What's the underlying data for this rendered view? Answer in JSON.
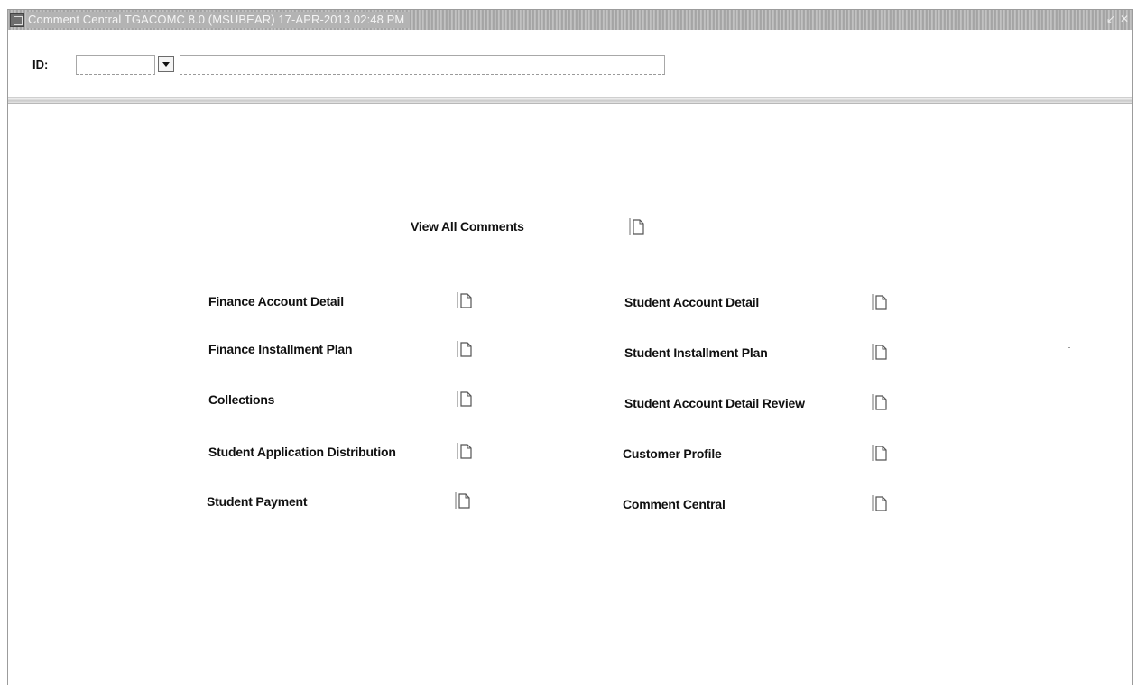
{
  "window": {
    "title": "Comment Central  TGACOMC  8.0  (MSUBEAR)   17-APR-2013 02:48 PM",
    "controls": [
      "↙",
      "✕"
    ]
  },
  "key_block": {
    "id_label": "ID:",
    "id_value": "",
    "name_value": ""
  },
  "main": {
    "view_all": {
      "label": "View All Comments",
      "icon": "document-icon"
    },
    "left_options": [
      {
        "label": "Finance Account Detail",
        "icon": "document-icon"
      },
      {
        "label": "Finance Installment Plan",
        "icon": "document-icon"
      },
      {
        "label": "Collections",
        "icon": "document-icon"
      },
      {
        "label": "Student Application Distribution",
        "icon": "document-icon"
      },
      {
        "label": "Student Payment",
        "icon": "document-icon"
      }
    ],
    "right_options": [
      {
        "label": "Student Account Detail",
        "icon": "document-icon"
      },
      {
        "label": "Student Installment Plan",
        "icon": "document-icon"
      },
      {
        "label": "Student Account Detail Review",
        "icon": "document-icon"
      },
      {
        "label": "Customer Profile",
        "icon": "document-icon"
      },
      {
        "label": "Comment Central",
        "icon": "document-icon"
      }
    ]
  }
}
